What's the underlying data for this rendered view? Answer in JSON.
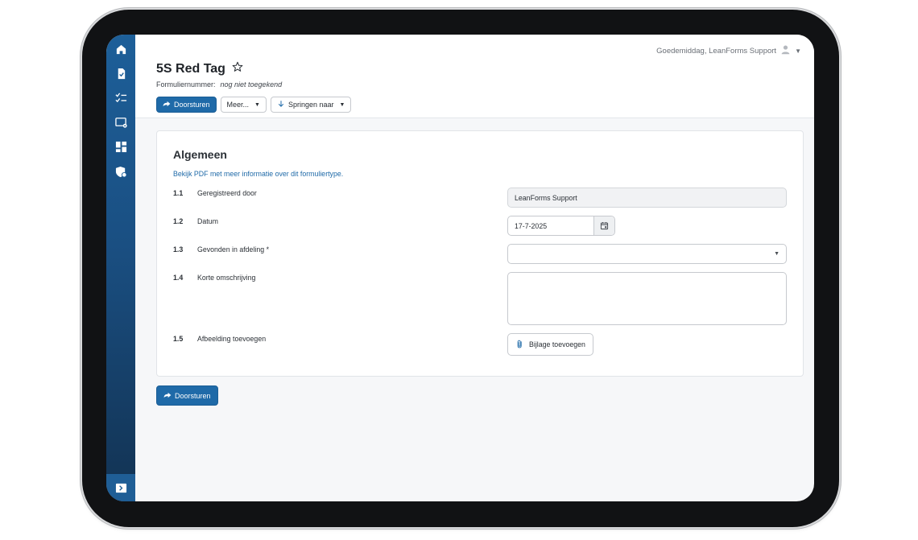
{
  "header": {
    "greeting": "Goedemiddag, LeanForms Support",
    "title": "5S Red Tag",
    "form_number_label": "Formuliernummer:",
    "form_number_value": "nog niet toegekend"
  },
  "toolbar": {
    "submit_label": "Doorsturen",
    "more_label": "Meer...",
    "jump_label": "Springen naar"
  },
  "sidebar": {
    "items": [
      {
        "icon": "home-icon"
      },
      {
        "icon": "document-check-icon"
      },
      {
        "icon": "checklist-icon"
      },
      {
        "icon": "screen-settings-icon"
      },
      {
        "icon": "dashboard-icon"
      },
      {
        "icon": "shield-settings-icon"
      }
    ],
    "bottom_icon": "expand-sidebar-icon"
  },
  "section": {
    "title": "Algemeen",
    "pdf_link": "Bekijk PDF met meer informatie over dit formuliertype.",
    "rows": [
      {
        "num": "1.1",
        "label": "Geregistreerd door",
        "value": "LeanForms Support"
      },
      {
        "num": "1.2",
        "label": "Datum",
        "value": "17-7-2025"
      },
      {
        "num": "1.3",
        "label": "Gevonden in afdeling *",
        "value": ""
      },
      {
        "num": "1.4",
        "label": "Korte omschrijving",
        "value": ""
      },
      {
        "num": "1.5",
        "label": "Afbeelding toevoegen",
        "value": ""
      }
    ],
    "attach_label": "Bijlage toevoegen"
  },
  "footer": {
    "submit_label": "Doorsturen"
  },
  "colors": {
    "primary": "#1f6aa8",
    "sidebar_top": "#1d5f99",
    "sidebar_bottom": "#123252"
  }
}
